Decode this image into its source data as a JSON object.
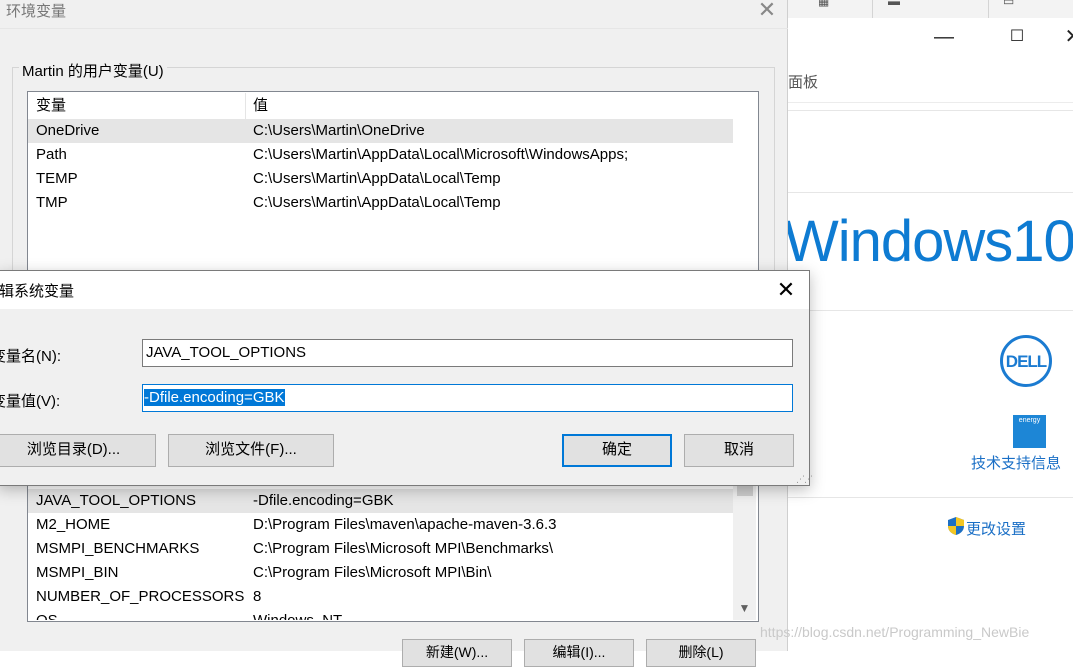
{
  "background_window": {
    "address_fragment": "面板",
    "logo_text": "Windows10",
    "oem_logo": "DELL",
    "energy_badge": "energy",
    "support_link": "技术支持信息",
    "change_settings_link": "更改设置",
    "icons": [
      "minimize-icon",
      "maximize-icon",
      "close-icon",
      "shield-icon"
    ]
  },
  "env_dialog": {
    "title": "环境变量",
    "user_group_label": "Martin 的用户变量(U)",
    "columns": [
      "变量",
      "值"
    ],
    "user_vars": [
      {
        "name": "OneDrive",
        "value": "C:\\Users\\Martin\\OneDrive"
      },
      {
        "name": "Path",
        "value": "C:\\Users\\Martin\\AppData\\Local\\Microsoft\\WindowsApps;"
      },
      {
        "name": "TEMP",
        "value": "C:\\Users\\Martin\\AppData\\Local\\Temp"
      },
      {
        "name": "TMP",
        "value": "C:\\Users\\Martin\\AppData\\Local\\Temp"
      }
    ],
    "system_vars": [
      {
        "name": "JAVA_TOOL_OPTIONS",
        "value": "-Dfile.encoding=GBK"
      },
      {
        "name": "M2_HOME",
        "value": "D:\\Program Files\\maven\\apache-maven-3.6.3"
      },
      {
        "name": "MSMPI_BENCHMARKS",
        "value": "C:\\Program Files\\Microsoft MPI\\Benchmarks\\"
      },
      {
        "name": "MSMPI_BIN",
        "value": "C:\\Program Files\\Microsoft MPI\\Bin\\"
      },
      {
        "name": "NUMBER_OF_PROCESSORS",
        "value": "8"
      },
      {
        "name": "OS",
        "value": "Windows_NT"
      }
    ],
    "bottom_buttons": [
      "新建(W)...",
      "编辑(I)...",
      "删除(L)"
    ]
  },
  "edit_dialog": {
    "title": "辑系统变量",
    "name_label": "变量名(N):",
    "value_label": "变量值(V):",
    "name_value": "JAVA_TOOL_OPTIONS",
    "value_value": "-Dfile.encoding=GBK",
    "browse_dir_label": "浏览目录(D)...",
    "browse_file_label": "浏览文件(F)...",
    "ok_label": "确定",
    "cancel_label": "取消"
  },
  "watermark": "https://blog.csdn.net/Programming_NewBie"
}
